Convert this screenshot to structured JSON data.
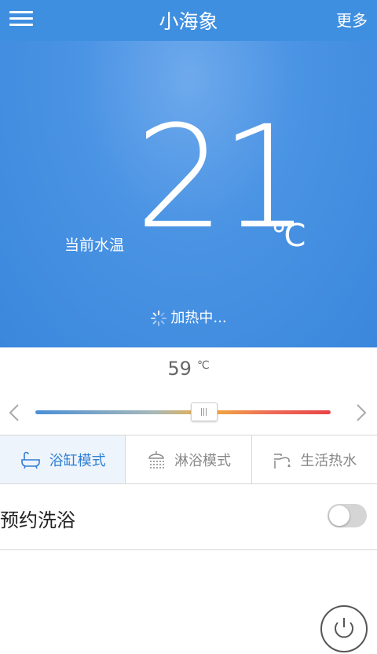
{
  "app": {
    "title": "小海象",
    "more_label": "更多"
  },
  "hero": {
    "current_label": "当前水温",
    "temperature": "21",
    "unit": "℃",
    "status": "加热中..."
  },
  "setpoint": {
    "value": "59",
    "unit": "℃"
  },
  "slider": {
    "fraction": 0.57
  },
  "modes": [
    {
      "label": "浴缸模式",
      "icon": "bathtub-icon",
      "active": true
    },
    {
      "label": "淋浴模式",
      "icon": "shower-icon",
      "active": false
    },
    {
      "label": "生活热水",
      "icon": "faucet-icon",
      "active": false
    }
  ],
  "appointment": {
    "label": "预约洗浴",
    "enabled": false
  },
  "colors": {
    "primary": "#3f8fe0",
    "active_tab": "#2f7fd6"
  }
}
